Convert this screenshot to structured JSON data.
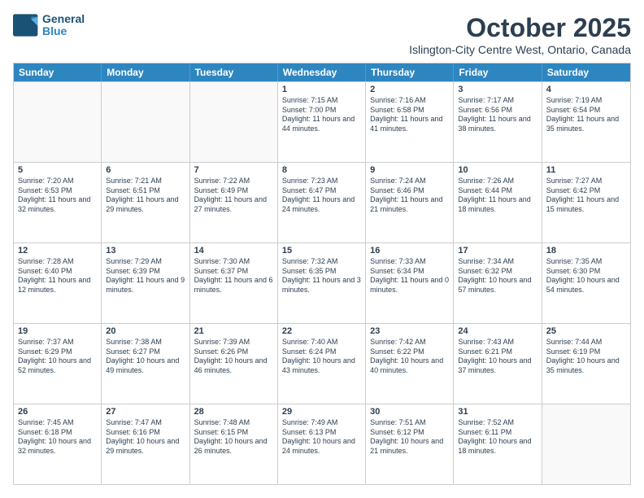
{
  "header": {
    "logo_line1": "General",
    "logo_line2": "Blue",
    "month_year": "October 2025",
    "location": "Islington-City Centre West, Ontario, Canada"
  },
  "days_of_week": [
    "Sunday",
    "Monday",
    "Tuesday",
    "Wednesday",
    "Thursday",
    "Friday",
    "Saturday"
  ],
  "weeks": [
    [
      {
        "day": "",
        "info": ""
      },
      {
        "day": "",
        "info": ""
      },
      {
        "day": "",
        "info": ""
      },
      {
        "day": "1",
        "info": "Sunrise: 7:15 AM\nSunset: 7:00 PM\nDaylight: 11 hours and 44 minutes."
      },
      {
        "day": "2",
        "info": "Sunrise: 7:16 AM\nSunset: 6:58 PM\nDaylight: 11 hours and 41 minutes."
      },
      {
        "day": "3",
        "info": "Sunrise: 7:17 AM\nSunset: 6:56 PM\nDaylight: 11 hours and 38 minutes."
      },
      {
        "day": "4",
        "info": "Sunrise: 7:19 AM\nSunset: 6:54 PM\nDaylight: 11 hours and 35 minutes."
      }
    ],
    [
      {
        "day": "5",
        "info": "Sunrise: 7:20 AM\nSunset: 6:53 PM\nDaylight: 11 hours and 32 minutes."
      },
      {
        "day": "6",
        "info": "Sunrise: 7:21 AM\nSunset: 6:51 PM\nDaylight: 11 hours and 29 minutes."
      },
      {
        "day": "7",
        "info": "Sunrise: 7:22 AM\nSunset: 6:49 PM\nDaylight: 11 hours and 27 minutes."
      },
      {
        "day": "8",
        "info": "Sunrise: 7:23 AM\nSunset: 6:47 PM\nDaylight: 11 hours and 24 minutes."
      },
      {
        "day": "9",
        "info": "Sunrise: 7:24 AM\nSunset: 6:46 PM\nDaylight: 11 hours and 21 minutes."
      },
      {
        "day": "10",
        "info": "Sunrise: 7:26 AM\nSunset: 6:44 PM\nDaylight: 11 hours and 18 minutes."
      },
      {
        "day": "11",
        "info": "Sunrise: 7:27 AM\nSunset: 6:42 PM\nDaylight: 11 hours and 15 minutes."
      }
    ],
    [
      {
        "day": "12",
        "info": "Sunrise: 7:28 AM\nSunset: 6:40 PM\nDaylight: 11 hours and 12 minutes."
      },
      {
        "day": "13",
        "info": "Sunrise: 7:29 AM\nSunset: 6:39 PM\nDaylight: 11 hours and 9 minutes."
      },
      {
        "day": "14",
        "info": "Sunrise: 7:30 AM\nSunset: 6:37 PM\nDaylight: 11 hours and 6 minutes."
      },
      {
        "day": "15",
        "info": "Sunrise: 7:32 AM\nSunset: 6:35 PM\nDaylight: 11 hours and 3 minutes."
      },
      {
        "day": "16",
        "info": "Sunrise: 7:33 AM\nSunset: 6:34 PM\nDaylight: 11 hours and 0 minutes."
      },
      {
        "day": "17",
        "info": "Sunrise: 7:34 AM\nSunset: 6:32 PM\nDaylight: 10 hours and 57 minutes."
      },
      {
        "day": "18",
        "info": "Sunrise: 7:35 AM\nSunset: 6:30 PM\nDaylight: 10 hours and 54 minutes."
      }
    ],
    [
      {
        "day": "19",
        "info": "Sunrise: 7:37 AM\nSunset: 6:29 PM\nDaylight: 10 hours and 52 minutes."
      },
      {
        "day": "20",
        "info": "Sunrise: 7:38 AM\nSunset: 6:27 PM\nDaylight: 10 hours and 49 minutes."
      },
      {
        "day": "21",
        "info": "Sunrise: 7:39 AM\nSunset: 6:26 PM\nDaylight: 10 hours and 46 minutes."
      },
      {
        "day": "22",
        "info": "Sunrise: 7:40 AM\nSunset: 6:24 PM\nDaylight: 10 hours and 43 minutes."
      },
      {
        "day": "23",
        "info": "Sunrise: 7:42 AM\nSunset: 6:22 PM\nDaylight: 10 hours and 40 minutes."
      },
      {
        "day": "24",
        "info": "Sunrise: 7:43 AM\nSunset: 6:21 PM\nDaylight: 10 hours and 37 minutes."
      },
      {
        "day": "25",
        "info": "Sunrise: 7:44 AM\nSunset: 6:19 PM\nDaylight: 10 hours and 35 minutes."
      }
    ],
    [
      {
        "day": "26",
        "info": "Sunrise: 7:45 AM\nSunset: 6:18 PM\nDaylight: 10 hours and 32 minutes."
      },
      {
        "day": "27",
        "info": "Sunrise: 7:47 AM\nSunset: 6:16 PM\nDaylight: 10 hours and 29 minutes."
      },
      {
        "day": "28",
        "info": "Sunrise: 7:48 AM\nSunset: 6:15 PM\nDaylight: 10 hours and 26 minutes."
      },
      {
        "day": "29",
        "info": "Sunrise: 7:49 AM\nSunset: 6:13 PM\nDaylight: 10 hours and 24 minutes."
      },
      {
        "day": "30",
        "info": "Sunrise: 7:51 AM\nSunset: 6:12 PM\nDaylight: 10 hours and 21 minutes."
      },
      {
        "day": "31",
        "info": "Sunrise: 7:52 AM\nSunset: 6:11 PM\nDaylight: 10 hours and 18 minutes."
      },
      {
        "day": "",
        "info": ""
      }
    ]
  ]
}
